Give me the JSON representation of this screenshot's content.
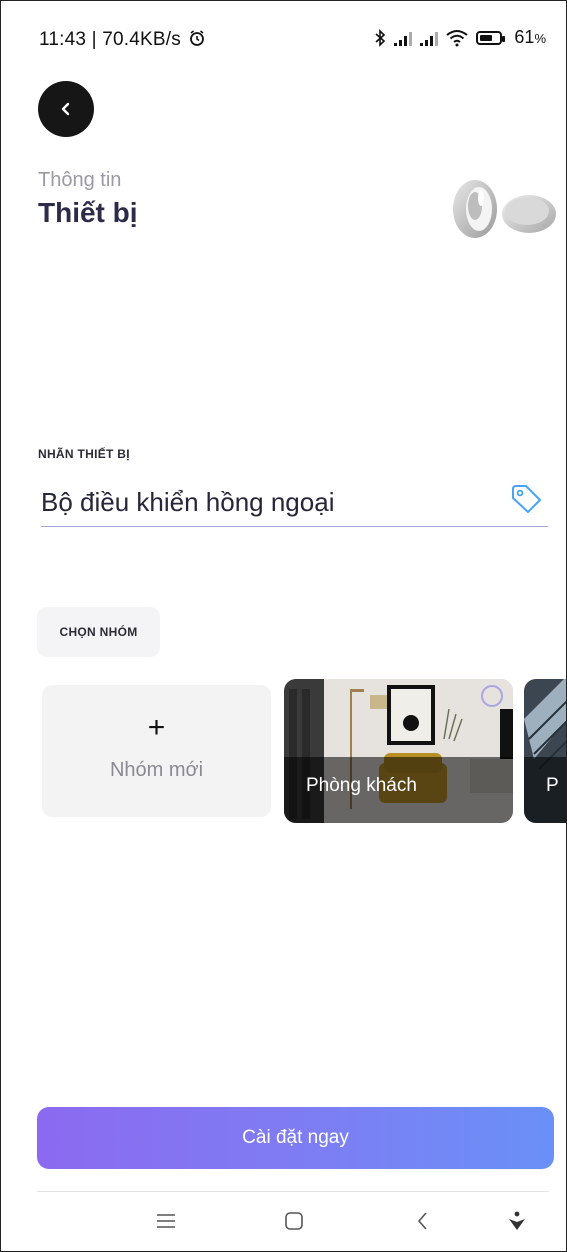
{
  "status_bar": {
    "time": "11:43 | 70.4KB/s",
    "battery": "61",
    "battery_unit": "%"
  },
  "header": {
    "subtitle": "Thông tin",
    "title": "Thiết bị"
  },
  "device_label": {
    "caption": "NHÃN THIẾT BỊ",
    "value": "Bộ điều khiển hồng ngoại"
  },
  "group": {
    "caption": "CHỌN NHÓM",
    "new_group_label": "Nhóm mới",
    "new_group_icon": "+",
    "rooms": [
      {
        "name": "Phòng khách"
      },
      {
        "name": "P"
      }
    ]
  },
  "install_button": {
    "label": "Cài đặt ngay"
  },
  "colors": {
    "accent_start": "#8b6af0",
    "accent_end": "#6a90f7",
    "title": "#2d2b4a"
  },
  "icons": [
    "alarm-icon",
    "bluetooth-icon",
    "signal-icon",
    "wifi-icon",
    "battery-icon",
    "back-icon",
    "tag-icon",
    "menu-icon",
    "home-icon",
    "back-nav-icon",
    "accessibility-icon"
  ]
}
